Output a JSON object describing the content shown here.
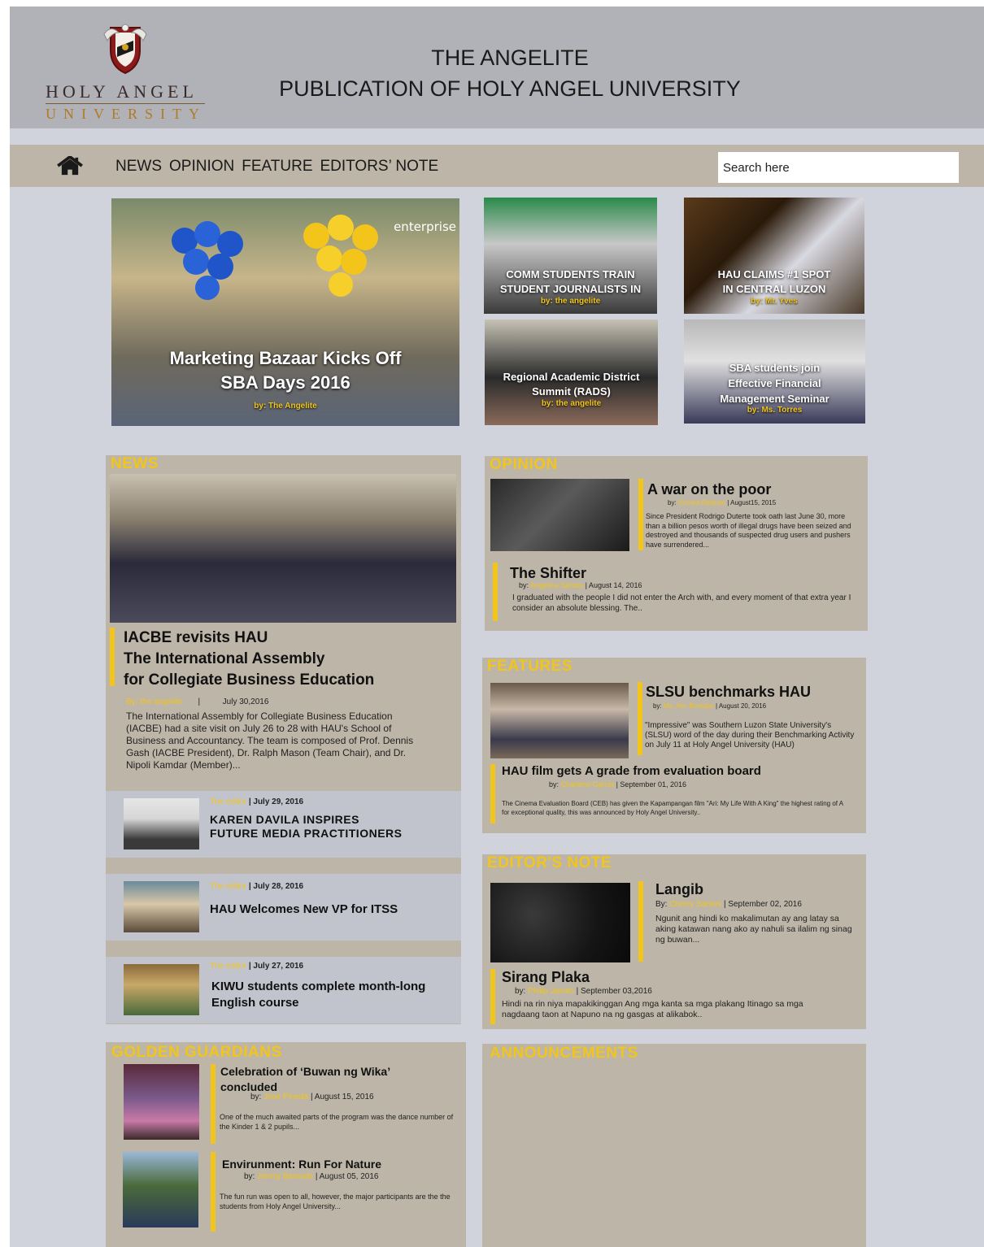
{
  "header": {
    "logo_line1": "HOLY ANGEL",
    "logo_line2": "UNIVERSITY",
    "title_line1": "THE ANGELITE",
    "title_line2": "PUBLICATION OF HOLY ANGEL UNIVERSITY"
  },
  "nav": {
    "items": [
      "NEWS",
      "OPINION",
      "FEATURE",
      "EDITORS’ NOTE"
    ],
    "search_placeholder": "Search here"
  },
  "hero": {
    "main": {
      "title_line1": "Marketing Bazaar Kicks Off",
      "title_line2": "SBA Days 2016",
      "by": "by: The Angelite",
      "watermark": "enterprise"
    },
    "tiles": [
      {
        "title_line1": "COMM STUDENTS TRAIN",
        "title_line2": "STUDENT JOURNALISTS IN",
        "by": "by: the angelite"
      },
      {
        "title_line1": "HAU CLAIMS #1 SPOT",
        "title_line2": "IN CENTRAL LUZON",
        "by": "by: Mr. Yves"
      },
      {
        "title_line1": "Regional Academic District",
        "title_line2": "Summit (RADS)",
        "by": "by: the angelite"
      },
      {
        "title_line1": "SBA students join",
        "title_line2": "Effective Financial",
        "title_line3": "Management Seminar",
        "by": "by: Ms. Torres"
      }
    ]
  },
  "news": {
    "section_title": "NEWS",
    "lead": {
      "title_line1": "IACBE revisits HAU",
      "title_line2": "The International Assembly",
      "title_line3": "for Collegiate Business Education",
      "author": "By: the angelite",
      "sep": "|",
      "date": "July 30,2016",
      "excerpt": "The International Assembly for Collegiate Business Education (IACBE) had a site visit on July 26 to 28 with HAU's School of Business and Accountancy. The team is composed of Prof. Dennis Gash (IACBE President), Dr. Ralph Mason (Team Chair), and Dr. Nipoli Kamdar (Member)..."
    },
    "items": [
      {
        "author": "The editor",
        "date": "| July 29, 2016",
        "title_line1": "KAREN DAVILA INSPIRES",
        "title_line2": "FUTURE MEDIA PRACTITIONERS"
      },
      {
        "author": "The editor",
        "date": "| July 28, 2016",
        "title_line1": "HAU Welcomes New VP for ITSS"
      },
      {
        "author": "The editor",
        "date": "| July 27, 2016",
        "title_line1": "KIWU students complete month-long",
        "title_line2": "English course"
      }
    ]
  },
  "opinion": {
    "section_title": "OPINION",
    "articles": [
      {
        "title": "A war on the poor",
        "by": "by:",
        "author": "Vincent Balahan",
        "date": "| August15, 2015",
        "excerpt": "Since President Rodrigo Duterte took oath last June 30, more than a billion pesos worth of illegal drugs have been seized and destroyed and thousands of suspected drug users and pushers have surrendered..."
      },
      {
        "title": "The Shifter",
        "by": "by:",
        "author": "Angelica Santos",
        "date": "| August 14, 2016",
        "excerpt": "I graduated with the people I did not enter the Arch with, and every moment of that extra year I consider an absolute blessing. The.."
      }
    ]
  },
  "features": {
    "section_title": "FEATURES",
    "articles": [
      {
        "title": "SLSU benchmarks HAU",
        "by": "by:",
        "author": "Ma. Ann Bernabe",
        "date": "| August 20, 2016",
        "excerpt": "\"Impressive\" was Southern Luzon State University's (SLSU) word of the day during their Benchmarking Activity on July 11 at Holy Angel University (HAU)"
      },
      {
        "title": "HAU film gets A grade from evaluation board",
        "by": "by:",
        "author": "Charlene Garcia",
        "date": "| September 01, 2016",
        "excerpt": "The Cinema Evaluation Board (CEB) has given the Kapampangan film \"Ari: My Life With A King\" the highest rating of A for exceptional quality, this was announced by Holy Angel University.."
      }
    ]
  },
  "editors_note": {
    "section_title": "EDITOR'S NOTE",
    "articles": [
      {
        "title": "Langib",
        "by": "By:",
        "author": "Cherry Santos",
        "date": "| September 02, 2016",
        "excerpt": "Ngunit ang hindi ko makalimutan ay ang latay sa aking katawan nang ako ay nahuli sa ilalim ng sinag ng buwan..."
      },
      {
        "title": "Sirang Plaka",
        "by": "by:",
        "author": "Philip Jamito",
        "date": "| September 03,2016",
        "excerpt": "Hindi na rin niya mapakikinggan Ang mga kanta sa mga plakang Itinago sa mga nagdaang taon at Napuno na ng gasgas at alikabok.."
      }
    ]
  },
  "golden": {
    "section_title": "GOLDEN GUARDIANS",
    "articles": [
      {
        "title_line1": "Celebration of ‘Buwan ng Wika’",
        "title_line2": "concluded",
        "by": "by:",
        "author": "Jose Pineda",
        "date": "| August  15, 2016",
        "excerpt": "One of the much awaited parts of the program was the dance number of the Kinder 1 & 2 pupils..."
      },
      {
        "title_line1": "Envirunment: Run For Nature",
        "by": "by:",
        "author": "Jimmy Bemudo",
        "date": "| August 05, 2016",
        "excerpt": "The fun run was open to all, however, the major participants are the the students from Holy Angel University..."
      }
    ]
  },
  "announcements": {
    "section_title": "ANNOUNCEMENTS"
  }
}
